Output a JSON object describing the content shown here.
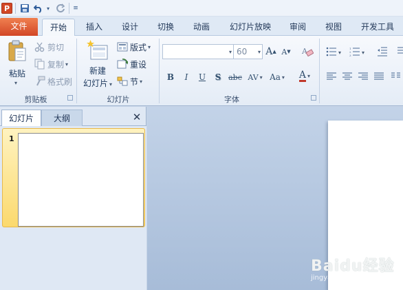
{
  "quick_access": {
    "app_icon_text": "P",
    "save_icon": "save-icon",
    "undo_icon": "undo-icon",
    "redo_icon": "redo-icon",
    "customize_icon": "customize-qat-icon"
  },
  "tabs": {
    "file": "文件",
    "home": "开始",
    "insert": "插入",
    "design": "设计",
    "transitions": "切换",
    "animations": "动画",
    "slideshow": "幻灯片放映",
    "review": "审阅",
    "view": "视图",
    "developer": "开发工具"
  },
  "clipboard": {
    "paste": "粘贴",
    "cut": "剪切",
    "copy": "复制",
    "format_painter": "格式刷",
    "group_label": "剪贴板"
  },
  "slides": {
    "new_slide_line1": "新建",
    "new_slide_line2": "幻灯片",
    "layout": "版式",
    "reset": "重设",
    "section": "节",
    "group_label": "幻灯片"
  },
  "font": {
    "font_name": "",
    "font_size": "60",
    "grow": "A",
    "shrink": "A",
    "bold": "B",
    "italic": "I",
    "underline": "U",
    "shadow": "S",
    "strikethrough": "abc",
    "spacing": "AV",
    "case": "Aa",
    "color": "A",
    "group_label": "字体"
  },
  "left_pane": {
    "tab_slides": "幻灯片",
    "tab_outline": "大纲",
    "close": "✕",
    "slide_number": "1"
  },
  "watermark": {
    "main": "Baidu经验",
    "sub": "jingyan.baidu.com"
  }
}
